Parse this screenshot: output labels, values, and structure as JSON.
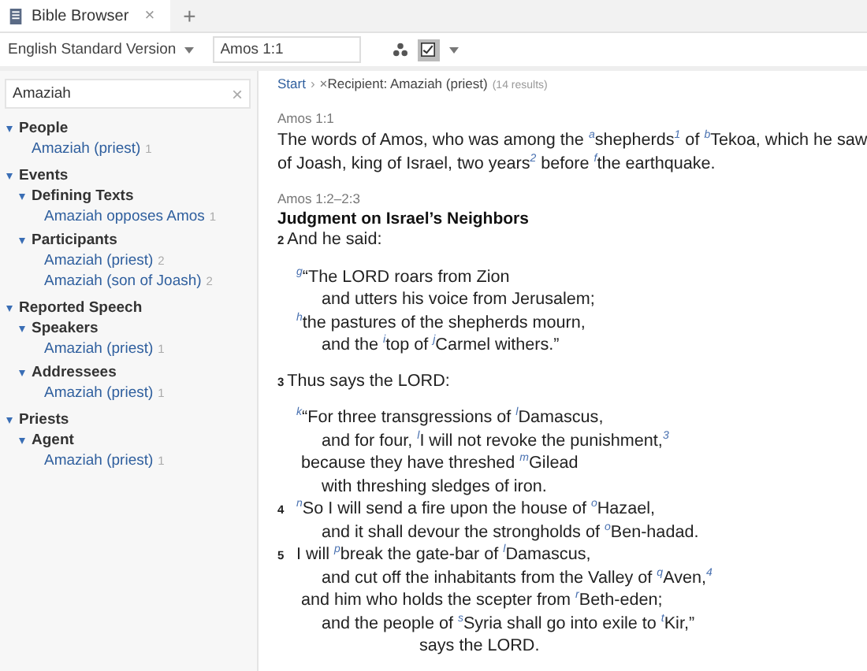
{
  "tabs": [
    {
      "title": "Bible Browser",
      "close": "×",
      "selected": true
    }
  ],
  "new_tab": "+",
  "toolbar": {
    "version": "English Standard Version",
    "reference": "Amos 1:1",
    "filters_on": true
  },
  "sidebar": {
    "search": {
      "value": "Amaziah",
      "clear": "×"
    },
    "tree": [
      {
        "label": "People",
        "expanded": true,
        "children": [
          {
            "label": "Amaziah (priest)",
            "count": "1"
          }
        ]
      },
      {
        "label": "Events",
        "expanded": true,
        "children": [
          {
            "label": "Defining Texts",
            "expanded": true,
            "children": [
              {
                "label": "Amaziah opposes Amos",
                "count": "1"
              }
            ]
          },
          {
            "label": "Participants",
            "expanded": true,
            "children": [
              {
                "label": "Amaziah (priest)",
                "count": "2"
              },
              {
                "label": "Amaziah (son of Joash)",
                "count": "2"
              }
            ]
          }
        ]
      },
      {
        "label": "Reported Speech",
        "expanded": true,
        "children": [
          {
            "label": "Speakers",
            "expanded": true,
            "children": [
              {
                "label": "Amaziah (priest)",
                "count": "1"
              }
            ]
          },
          {
            "label": "Addressees",
            "expanded": true,
            "children": [
              {
                "label": "Amaziah (priest)",
                "count": "1"
              }
            ]
          }
        ]
      },
      {
        "label": "Priests",
        "expanded": true,
        "children": [
          {
            "label": "Agent",
            "expanded": true,
            "children": [
              {
                "label": "Amaziah (priest)",
                "count": "1"
              }
            ]
          }
        ]
      }
    ]
  },
  "breadcrumb": {
    "start": "Start",
    "separator": "›",
    "remove": "×",
    "filter": "Recipient: Amaziah (priest)",
    "count": "(14 results)"
  },
  "sections": [
    {
      "reference": "Amos 1:1",
      "stanzas": [
        [
          {
            "kind": "flush",
            "text": "The words of Amos, who was among the $^{a}$shepherds$^{1}$ of $^{b}$Tekoa, which he saw"
          },
          {
            "kind": "flush",
            "text": "of Joash, king of Israel, two years$^{2}$ before $^{f}$the earthquake."
          }
        ]
      ]
    },
    {
      "reference": "Amos 1:2–2:3",
      "heading": "Judgment on Israel’s Neighbors",
      "stanzas": [
        [
          {
            "kind": "flush",
            "verse": "2",
            "text": "And he said:"
          }
        ],
        [
          {
            "kind": "first",
            "text": "$^{g}$“The LORD roars from Zion"
          },
          {
            "kind": "indent",
            "text": "and utters his voice from Jerusalem;"
          },
          {
            "kind": "first",
            "text": "$^{h}$the pastures of the shepherds mourn,"
          },
          {
            "kind": "indent",
            "text": "and the $^{i}$top of $^{j}$Carmel withers.”"
          }
        ],
        [
          {
            "kind": "flush",
            "verse": "3",
            "text": "Thus says the LORD:"
          }
        ],
        [
          {
            "kind": "first",
            "text": "$^{k}$“For three transgressions of $^{l}$Damascus,"
          },
          {
            "kind": "indent",
            "text": "and for four, $^{l}$I will not revoke the punishment,$^{3}$"
          },
          {
            "kind": "hang",
            "text": "because they have threshed $^{m}$Gilead"
          },
          {
            "kind": "indent",
            "text": "with threshing sledges of iron."
          },
          {
            "kind": "first",
            "verse": "4",
            "text": "$^{n}$So I will send a fire upon the house of $^{o}$Hazael,"
          },
          {
            "kind": "indent",
            "text": "and it shall devour the strongholds of $^{o}$Ben-hadad."
          },
          {
            "kind": "first",
            "verse": "5",
            "text": "I will $^{p}$break the gate-bar of $^{l}$Damascus,"
          },
          {
            "kind": "indent",
            "text": "and cut off the inhabitants from the Valley of $^{q}$Aven,$^{4}$"
          },
          {
            "kind": "hang",
            "text": "and him who holds the scepter from $^{r}$Beth-eden;"
          },
          {
            "kind": "indent",
            "text": "and the people of $^{s}$Syria shall go into exile to $^{t}$Kir,”"
          },
          {
            "kind": "center",
            "text": "says the LORD."
          }
        ]
      ]
    }
  ]
}
